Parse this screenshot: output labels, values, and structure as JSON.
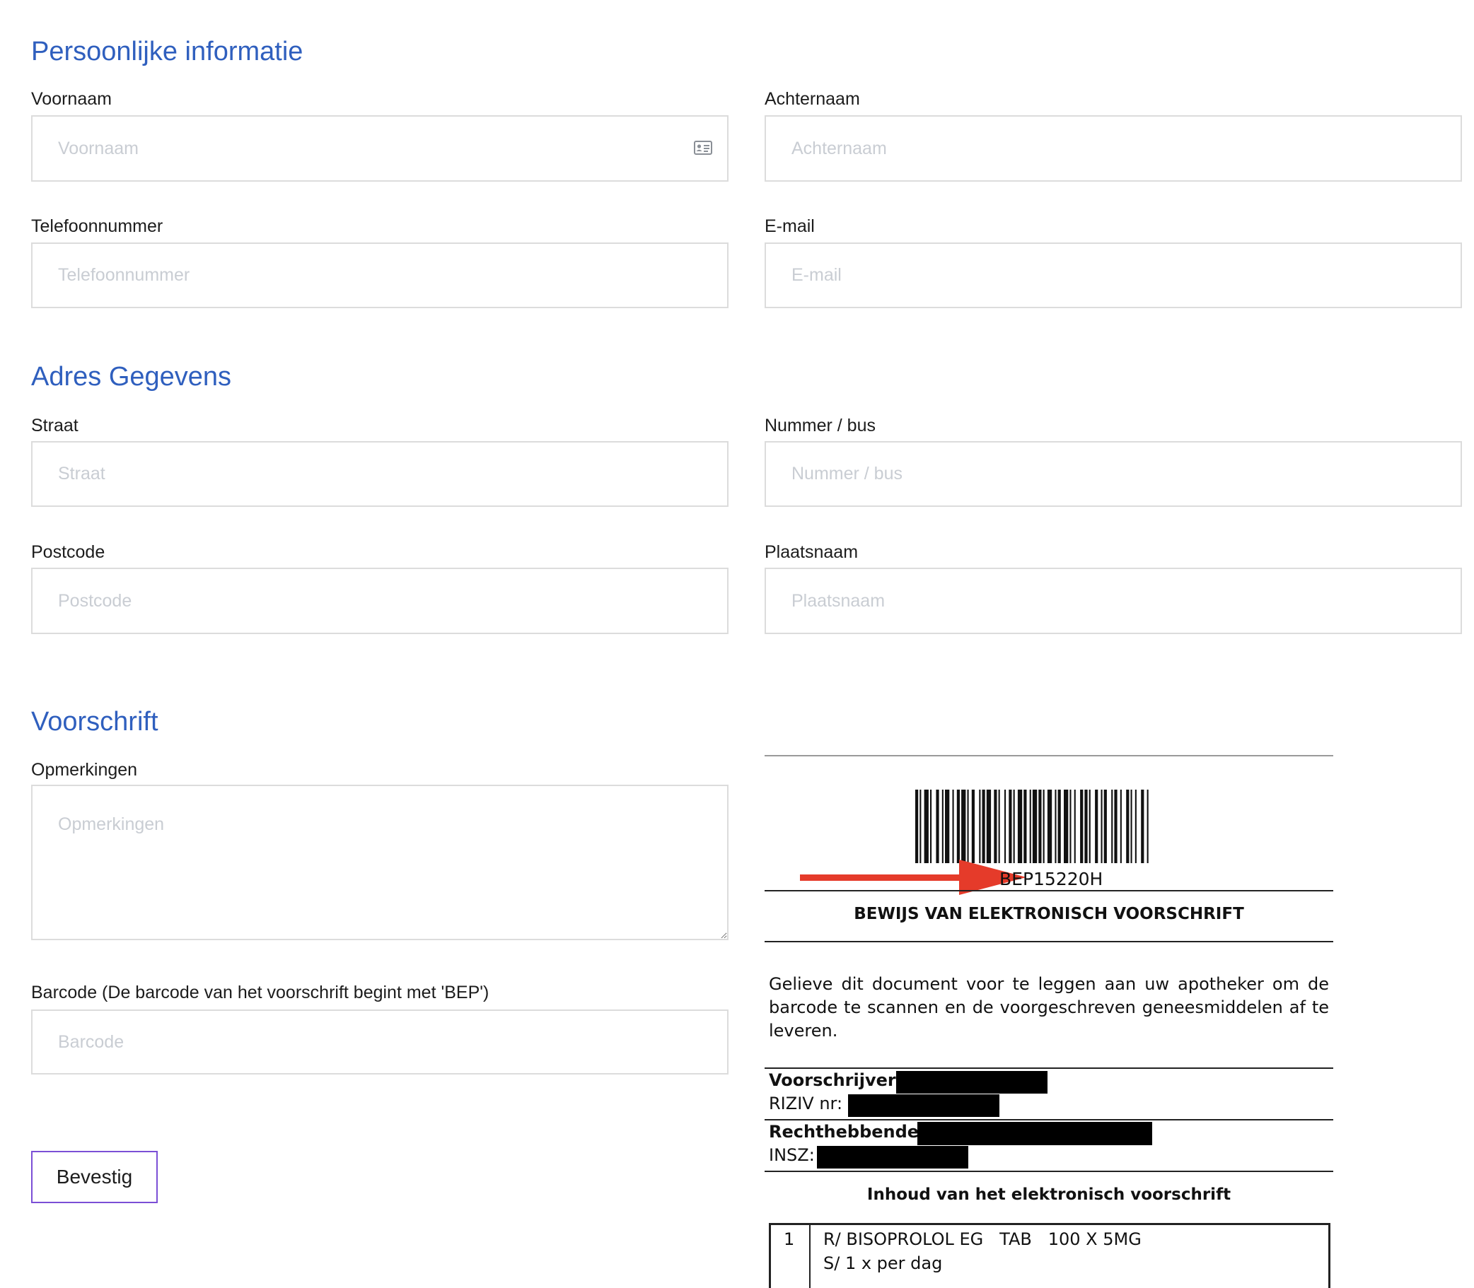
{
  "personal": {
    "title": "Persoonlijke informatie",
    "first_name": {
      "label": "Voornaam",
      "placeholder": "Voornaam",
      "icon": "id-card-icon"
    },
    "last_name": {
      "label": "Achternaam",
      "placeholder": "Achternaam"
    },
    "phone": {
      "label": "Telefoonnummer",
      "placeholder": "Telefoonnummer"
    },
    "email": {
      "label": "E-mail",
      "placeholder": "E-mail"
    }
  },
  "address": {
    "title": "Adres Gegevens",
    "street": {
      "label": "Straat",
      "placeholder": "Straat"
    },
    "number": {
      "label": "Nummer / bus",
      "placeholder": "Nummer / bus"
    },
    "postcode": {
      "label": "Postcode",
      "placeholder": "Postcode"
    },
    "city": {
      "label": "Plaatsnaam",
      "placeholder": "Plaatsnaam"
    }
  },
  "prescription": {
    "title": "Voorschrift",
    "remarks": {
      "label": "Opmerkingen",
      "placeholder": "Opmerkingen"
    },
    "barcode": {
      "label": "Barcode (De barcode van het voorschrift begint met 'BEP')",
      "placeholder": "Barcode"
    },
    "confirm_label": "Bevestig"
  },
  "example_document": {
    "barcode_code": "BEP15220H",
    "heading": "BEWIJS VAN ELEKTRONISCH VOORSCHRIFT",
    "instructions": "Gelieve dit document voor te leggen aan uw apotheker om de barcode te scannen en de voorgeschreven geneesmiddelen af te leveren.",
    "prescriber_label": "Voorschrijver:",
    "riziv_label": "RIZIV nr:",
    "beneficiary_label": "Rechthebbende:",
    "insz_label": "INSZ:",
    "content_heading": "Inhoud van het elektronisch voorschrift",
    "item_number": "1",
    "item_line1": "R/ BISOPROLOL EG   TAB   100 X 5MG",
    "item_line2": "S/ 1 x per dag",
    "arrow_color": "#e53b2a"
  }
}
